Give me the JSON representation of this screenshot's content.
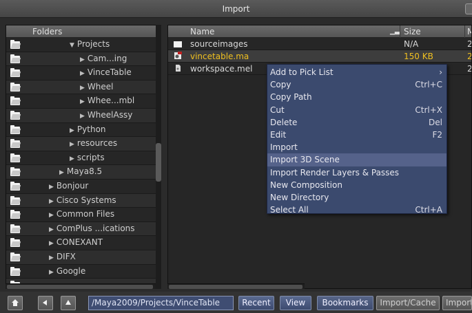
{
  "window": {
    "title": "Import"
  },
  "folders": {
    "header": "Folders",
    "items": [
      {
        "label": "Projects",
        "expander": "▼",
        "indent": 3
      },
      {
        "label": "Cam...ing",
        "expander": "▶",
        "indent": 4
      },
      {
        "label": "VinceTable",
        "expander": "▶",
        "indent": 4
      },
      {
        "label": "Wheel",
        "expander": "▶",
        "indent": 4
      },
      {
        "label": "Whee...mbl",
        "expander": "▶",
        "indent": 4
      },
      {
        "label": "WheelAssy",
        "expander": "▶",
        "indent": 4
      },
      {
        "label": "Python",
        "expander": "▶",
        "indent": 3
      },
      {
        "label": "resources",
        "expander": "▶",
        "indent": 3
      },
      {
        "label": "scripts",
        "expander": "▶",
        "indent": 3
      },
      {
        "label": "Maya8.5",
        "expander": "▶",
        "indent": 2
      },
      {
        "label": "Bonjour",
        "expander": "▶",
        "indent": 1
      },
      {
        "label": "Cisco Systems",
        "expander": "▶",
        "indent": 1
      },
      {
        "label": "Common Files",
        "expander": "▶",
        "indent": 1
      },
      {
        "label": "ComPlus ...ications",
        "expander": "▶",
        "indent": 1
      },
      {
        "label": "CONEXANT",
        "expander": "▶",
        "indent": 1
      },
      {
        "label": "DIFX",
        "expander": "▶",
        "indent": 1
      },
      {
        "label": "Google",
        "expander": "▶",
        "indent": 1
      },
      {
        "label": "",
        "expander": "",
        "indent": 1
      }
    ]
  },
  "files": {
    "columns": {
      "name": "Name",
      "size": "Size",
      "modified": "M"
    },
    "rows": [
      {
        "name": "sourceimages",
        "size": "N/A",
        "modified": "2",
        "icon": "folder-icon"
      },
      {
        "name": "vincetable.ma",
        "size": "150 KB",
        "modified": "2",
        "icon": "maya-file-icon",
        "selected": true
      },
      {
        "name": "workspace.mel",
        "size": "",
        "modified": "2",
        "icon": "script-file-icon"
      }
    ]
  },
  "context_menu": {
    "items": [
      {
        "label": "Add to Pick List",
        "shortcut": "›"
      },
      {
        "label": "Copy",
        "shortcut": "Ctrl+C"
      },
      {
        "label": "Copy Path",
        "shortcut": ""
      },
      {
        "label": "Cut",
        "shortcut": "Ctrl+X"
      },
      {
        "label": "Delete",
        "shortcut": "Del"
      },
      {
        "label": "Edit",
        "shortcut": "F2"
      },
      {
        "label": "Import",
        "shortcut": ""
      },
      {
        "label": "Import 3D Scene",
        "shortcut": "",
        "highlighted": true
      },
      {
        "label": "Import Render Layers & Passes",
        "shortcut": ""
      },
      {
        "label": "New Composition",
        "shortcut": ""
      },
      {
        "label": "New Directory",
        "shortcut": ""
      },
      {
        "label": "Select All",
        "shortcut": "Ctrl+A"
      }
    ]
  },
  "toolbar": {
    "home_icon": "home-icon",
    "back_icon": "back-arrow-icon",
    "up_icon": "up-arrow-icon",
    "path": "/Maya2009/Projects/VinceTable",
    "recent": "Recent",
    "view": "View",
    "bookmarks": "Bookmarks",
    "import_cache": "Import/Cache",
    "import": "Import"
  },
  "colors": {
    "selection_text": "#f0c020",
    "menu_bg": "#3b4a6e",
    "menu_highlight": "#55628a"
  }
}
